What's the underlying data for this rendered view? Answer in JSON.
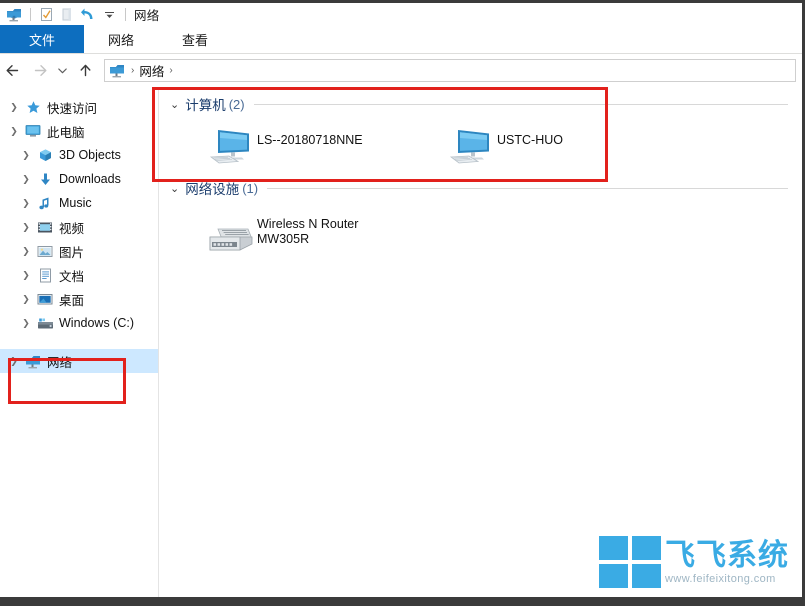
{
  "window": {
    "title": "网络",
    "app_icon": "network-folder-icon",
    "quick_access_toolbar": [
      {
        "name": "properties-icon",
        "label": "属性"
      },
      {
        "name": "new-folder-icon",
        "label": "新建文件夹"
      },
      {
        "name": "undo-icon",
        "label": "撤消"
      },
      {
        "name": "customize-dropdown-icon",
        "label": "自定义快速访问工具栏"
      }
    ]
  },
  "ribbon": {
    "tabs": [
      {
        "label": "文件",
        "active": true
      },
      {
        "label": "网络",
        "active": false
      },
      {
        "label": "查看",
        "active": false
      }
    ]
  },
  "navbar": {
    "back_label": "后退",
    "forward_label": "前进",
    "recent_label": "最近浏览的位置",
    "up_label": "上移一级",
    "address": {
      "icon": "network-folder-icon",
      "crumbs": [
        "网络"
      ],
      "separator": "›"
    }
  },
  "sidebar": {
    "items": [
      {
        "label": "快速访问",
        "icon": "star-icon",
        "level": 0,
        "expanded": false,
        "has_chevron": true,
        "selected": false
      },
      {
        "label": "此电脑",
        "icon": "monitor-icon",
        "level": 0,
        "expanded": true,
        "has_chevron": true,
        "selected": false
      },
      {
        "label": "3D Objects",
        "icon": "cube-icon",
        "level": 1,
        "expanded": false,
        "has_chevron": true,
        "selected": false
      },
      {
        "label": "Downloads",
        "icon": "download-arrow-icon",
        "level": 1,
        "expanded": false,
        "has_chevron": true,
        "selected": false
      },
      {
        "label": "Music",
        "icon": "music-note-icon",
        "level": 1,
        "expanded": false,
        "has_chevron": true,
        "selected": false
      },
      {
        "label": "视频",
        "icon": "video-icon",
        "level": 1,
        "expanded": false,
        "has_chevron": true,
        "selected": false
      },
      {
        "label": "图片",
        "icon": "pictures-icon",
        "level": 1,
        "expanded": false,
        "has_chevron": true,
        "selected": false
      },
      {
        "label": "文档",
        "icon": "documents-icon",
        "level": 1,
        "expanded": false,
        "has_chevron": true,
        "selected": false
      },
      {
        "label": "桌面",
        "icon": "desktop-icon",
        "level": 1,
        "expanded": false,
        "has_chevron": true,
        "selected": false
      },
      {
        "label": "Windows (C:)",
        "icon": "hard-drive-icon",
        "level": 1,
        "expanded": false,
        "has_chevron": true,
        "selected": false
      },
      {
        "label": "网络",
        "icon": "network-folder-icon",
        "level": 0,
        "expanded": false,
        "has_chevron": true,
        "selected": true
      }
    ]
  },
  "main": {
    "groups": [
      {
        "title": "计算机",
        "count": "(2)",
        "expanded": true,
        "items": [
          {
            "label": "LS--20180718NNE",
            "icon": "computer-icon"
          },
          {
            "label": "USTC-HUO",
            "icon": "computer-icon"
          }
        ]
      },
      {
        "title": "网络设施",
        "count": "(1)",
        "expanded": true,
        "items": [
          {
            "label": "Wireless N Router\nMW305R",
            "icon": "router-icon"
          }
        ]
      }
    ]
  },
  "annotations": [
    {
      "name": "computers-group-highlight",
      "color": "#e2211c"
    },
    {
      "name": "network-nav-item-highlight",
      "color": "#e2211c"
    }
  ],
  "watermark": {
    "brand": "飞飞系统",
    "url": "www.feifeixitong.com",
    "logo": "windows-logo-icon"
  },
  "colors": {
    "accent": "#0d6ebf",
    "selection": "#cde8ff",
    "annotation": "#e2211c",
    "group_title": "#1b3d6d",
    "watermark": "#3aabe4"
  }
}
